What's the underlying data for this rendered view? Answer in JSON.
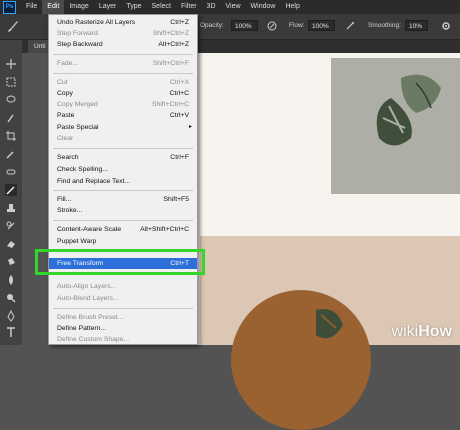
{
  "menubar": {
    "logo": "Ps",
    "items": [
      "File",
      "Edit",
      "Image",
      "Layer",
      "Type",
      "Select",
      "Filter",
      "3D",
      "View",
      "Window",
      "Help"
    ],
    "active": "Edit"
  },
  "options": {
    "opacity_label": "Opacity:",
    "opacity_value": "100%",
    "flow_label": "Flow:",
    "flow_value": "100%",
    "smoothing_label": "Smoothing:",
    "smoothing_value": "10%"
  },
  "tab": {
    "label": "Unti"
  },
  "edit_menu": {
    "items": [
      {
        "label": "Undo Rasterize All Layers",
        "shortcut": "Ctrl+Z",
        "enabled": true
      },
      {
        "label": "Step Forward",
        "shortcut": "Shift+Ctrl+Z",
        "enabled": false
      },
      {
        "label": "Step Backward",
        "shortcut": "Alt+Ctrl+Z",
        "enabled": true
      },
      {
        "label": "Fade...",
        "shortcut": "Shift+Ctrl+F",
        "enabled": false
      },
      {
        "label": "Cut",
        "shortcut": "Ctrl+X",
        "enabled": false
      },
      {
        "label": "Copy",
        "shortcut": "Ctrl+C",
        "enabled": true
      },
      {
        "label": "Copy Merged",
        "shortcut": "Shift+Ctrl+C",
        "enabled": false
      },
      {
        "label": "Paste",
        "shortcut": "Ctrl+V",
        "enabled": true
      },
      {
        "label": "Paste Special",
        "shortcut": "",
        "enabled": true,
        "submenu": true
      },
      {
        "label": "Clear",
        "shortcut": "",
        "enabled": false
      },
      {
        "label": "Search",
        "shortcut": "Ctrl+F",
        "enabled": true
      },
      {
        "label": "Check Spelling...",
        "shortcut": "",
        "enabled": true
      },
      {
        "label": "Find and Replace Text...",
        "shortcut": "",
        "enabled": true
      },
      {
        "label": "Fill...",
        "shortcut": "Shift+F5",
        "enabled": true
      },
      {
        "label": "Stroke...",
        "shortcut": "",
        "enabled": true
      },
      {
        "label": "Content-Aware Scale",
        "shortcut": "Alt+Shift+Ctrl+C",
        "enabled": true
      },
      {
        "label": "Puppet Warp",
        "shortcut": "",
        "enabled": true
      },
      {
        "label": "Free Transform",
        "shortcut": "Ctrl+T",
        "enabled": true,
        "highlighted": true
      },
      {
        "label": "Auto-Align Layers...",
        "shortcut": "",
        "enabled": false
      },
      {
        "label": "Auto-Blend Layers...",
        "shortcut": "",
        "enabled": false
      },
      {
        "label": "Define Brush Preset...",
        "shortcut": "",
        "enabled": false
      },
      {
        "label": "Define Pattern...",
        "shortcut": "",
        "enabled": true
      },
      {
        "label": "Define Custom Shape...",
        "shortcut": "",
        "enabled": false
      }
    ]
  },
  "watermark": {
    "part1": "wiki",
    "part2": "How"
  },
  "colors": {
    "menu_highlight": "#2d6fd8",
    "annotation_green": "#35d62a"
  }
}
